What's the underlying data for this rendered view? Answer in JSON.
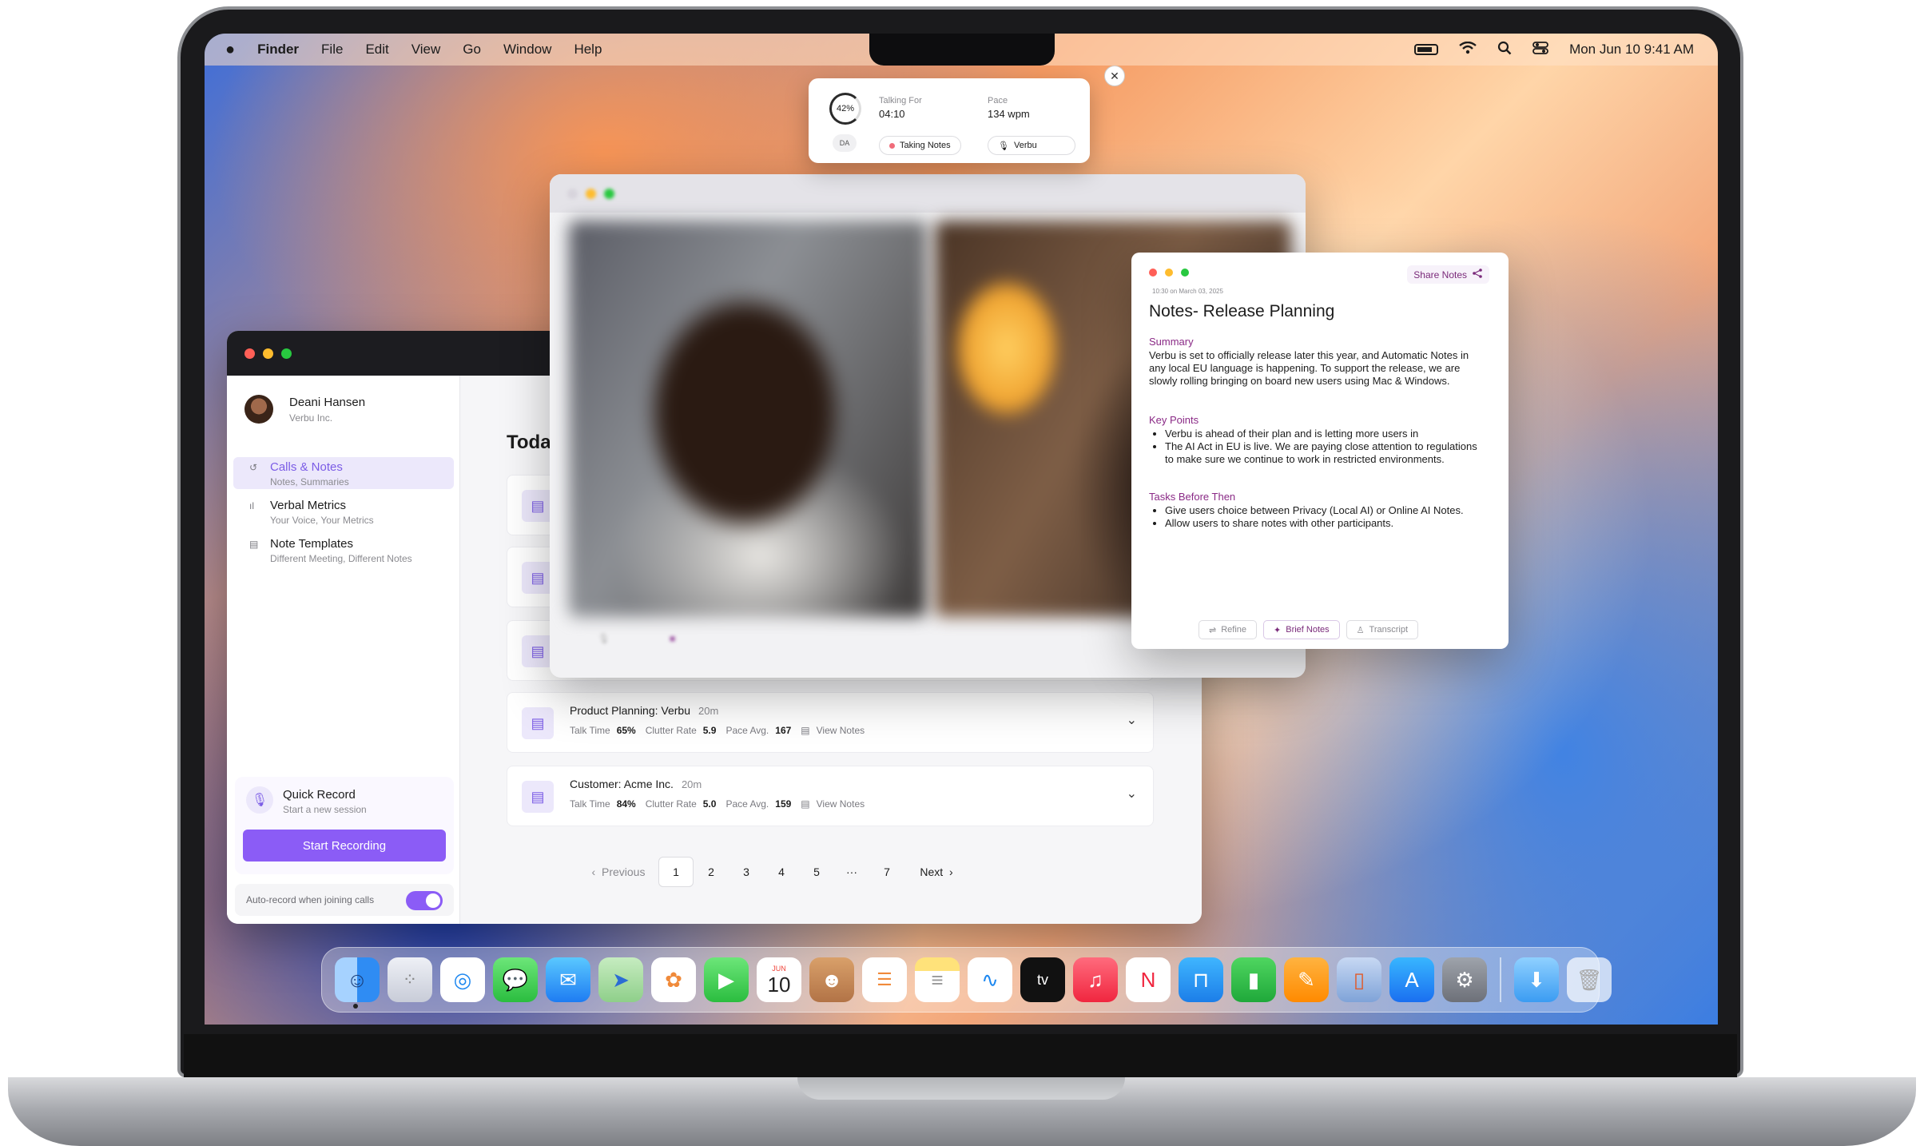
{
  "menubar": {
    "apple": "",
    "items": [
      "Finder",
      "File",
      "Edit",
      "View",
      "Go",
      "Window",
      "Help"
    ],
    "datetime": "Mon Jun 10  9:41 AM"
  },
  "talking": {
    "percent": "42%",
    "initials": "DA",
    "talking_for_label": "Talking For",
    "talking_for_value": "04:10",
    "pace_label": "Pace",
    "pace_value": "134 wpm",
    "chip_notes": "Taking Notes",
    "chip_verbu": "Verbu",
    "close": "✕"
  },
  "app": {
    "user_name": "Deani Hansen",
    "user_org": "Verbu Inc.",
    "nav": [
      {
        "label": "Calls & Notes",
        "sub": "Notes, Summaries",
        "icon": "↺"
      },
      {
        "label": "Verbal Metrics",
        "sub": "Your Voice, Your Metrics",
        "icon": "ıl"
      },
      {
        "label": "Note Templates",
        "sub": "Different Meeting, Different Notes",
        "icon": "▤"
      }
    ],
    "quick_record_title": "Quick Record",
    "quick_record_sub": "Start a new session",
    "start_recording": "Start Recording",
    "auto_record": "Auto-record when joining calls",
    "auto_record_on": true,
    "main_title": "Today",
    "cards": [
      {
        "title": "Product Planning: Verbu",
        "duration": "20m",
        "talk_time_label": "Talk Time",
        "talk_time": "65%",
        "clutter_label": "Clutter Rate",
        "clutter": "5.9",
        "pace_label": "Pace Avg.",
        "pace": "167",
        "view_notes": "View Notes"
      },
      {
        "title": "Customer: Acme Inc.",
        "duration": "20m",
        "talk_time_label": "Talk Time",
        "talk_time": "84%",
        "clutter_label": "Clutter Rate",
        "clutter": "5.0",
        "pace_label": "Pace Avg.",
        "pace": "159",
        "view_notes": "View Notes"
      }
    ],
    "pager": {
      "prev": "Previous",
      "pages": [
        "1",
        "2",
        "3",
        "4",
        "5",
        "···",
        "7"
      ],
      "current": "1",
      "next": "Next"
    }
  },
  "notes": {
    "share": "Share Notes",
    "date": "10:30 on March 03, 2025",
    "title": "Notes- Release Planning",
    "summary_heading": "Summary",
    "summary": "Verbu is set to officially release later this year, and Automatic Notes in any local EU language is happening. To support the release, we are slowly rolling bringing on board new users using Mac & Windows.",
    "key_points_heading": "Key Points",
    "key_points": [
      "Verbu is ahead of their plan and is letting more users in",
      "The AI Act in EU is live. We are paying close attention to regulations to make sure we continue to work in restricted environments."
    ],
    "tasks_heading": "Tasks Before Then",
    "tasks": [
      "Give users choice between Privacy (Local AI) or Online AI Notes.",
      "Allow users to share notes with other participants."
    ],
    "btn_refine": "Refine",
    "btn_brief": "Brief Notes",
    "btn_transcript": "Transcript"
  },
  "dock": {
    "calendar_month": "JUN",
    "calendar_day": "10",
    "tv_label": "tv"
  },
  "colors": {
    "accent": "#8b5cf6",
    "notes_heading": "#8a2a86",
    "window_red": "#ff5f57",
    "window_yellow": "#febc2e",
    "window_green": "#28c840"
  }
}
